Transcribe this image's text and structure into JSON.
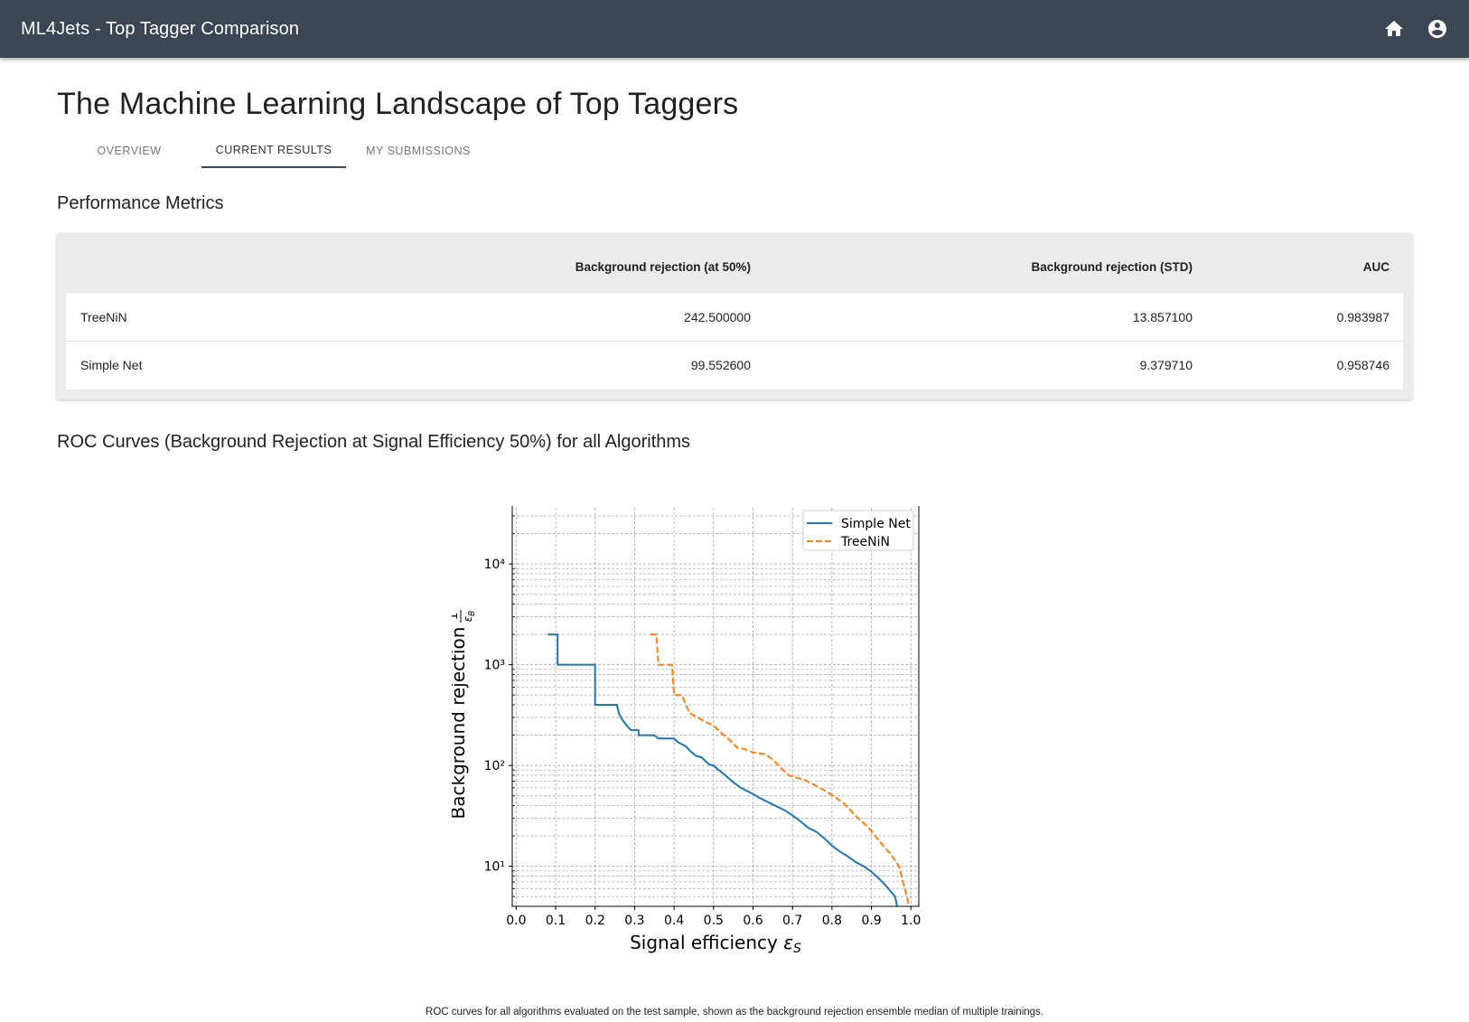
{
  "header": {
    "app_title": "ML4Jets - Top Tagger Comparison",
    "icons": [
      "home-icon",
      "account-circle-icon"
    ]
  },
  "page": {
    "title": "The Machine Learning Landscape of Top Taggers",
    "tabs": [
      {
        "label": "OVERVIEW",
        "active": false
      },
      {
        "label": "CURRENT RESULTS",
        "active": true
      },
      {
        "label": "MY SUBMISSIONS",
        "active": false
      }
    ]
  },
  "metrics": {
    "title": "Performance Metrics",
    "columns": [
      "",
      "Background rejection (at 50%)",
      "Background rejection (STD)",
      "AUC"
    ],
    "rows": [
      {
        "name": "TreeNiN",
        "rej50": "242.500000",
        "std": "13.857100",
        "auc": "0.983987"
      },
      {
        "name": "Simple Net",
        "rej50": "99.552600",
        "std": "9.379710",
        "auc": "0.958746"
      }
    ]
  },
  "roc": {
    "title": "ROC Curves (Background Rejection at Signal Efficiency 50%) for all Algorithms",
    "caption": "ROC curves for all algorithms evaluated on the test sample, shown as the background rejection ensemble median of multiple trainings."
  },
  "chart_data": {
    "type": "line",
    "xlabel": "Signal efficiency ε_S",
    "ylabel": "Background rejection 1/ε_B",
    "xlim": [
      -0.01,
      1.02
    ],
    "ylim": [
      4,
      40000
    ],
    "yscale": "log",
    "xticks": [
      "0.0",
      "0.1",
      "0.2",
      "0.3",
      "0.4",
      "0.5",
      "0.6",
      "0.7",
      "0.8",
      "0.9",
      "1.0"
    ],
    "yticks": [
      "10¹",
      "10²",
      "10³",
      "10⁴"
    ],
    "grid": true,
    "legend_position": "top-right",
    "series": [
      {
        "name": "Simple Net",
        "color": "#1f77b4",
        "style": "solid",
        "points": [
          [
            0.08,
            2000
          ],
          [
            0.105,
            2000
          ],
          [
            0.105,
            1000
          ],
          [
            0.2,
            1000
          ],
          [
            0.2,
            400
          ],
          [
            0.255,
            400
          ],
          [
            0.26,
            330
          ],
          [
            0.27,
            280
          ],
          [
            0.28,
            250
          ],
          [
            0.29,
            225
          ],
          [
            0.31,
            225
          ],
          [
            0.31,
            200
          ],
          [
            0.35,
            200
          ],
          [
            0.36,
            185
          ],
          [
            0.4,
            185
          ],
          [
            0.41,
            170
          ],
          [
            0.43,
            155
          ],
          [
            0.44,
            140
          ],
          [
            0.455,
            125
          ],
          [
            0.47,
            120
          ],
          [
            0.48,
            110
          ],
          [
            0.49,
            102
          ],
          [
            0.5,
            100
          ],
          [
            0.51,
            92
          ],
          [
            0.53,
            80
          ],
          [
            0.55,
            68
          ],
          [
            0.57,
            60
          ],
          [
            0.6,
            52
          ],
          [
            0.62,
            47
          ],
          [
            0.65,
            41
          ],
          [
            0.68,
            36
          ],
          [
            0.7,
            32
          ],
          [
            0.72,
            28
          ],
          [
            0.74,
            24
          ],
          [
            0.76,
            22
          ],
          [
            0.78,
            19
          ],
          [
            0.8,
            16
          ],
          [
            0.82,
            14
          ],
          [
            0.84,
            12.5
          ],
          [
            0.86,
            11
          ],
          [
            0.88,
            10
          ],
          [
            0.9,
            8.8
          ],
          [
            0.92,
            7.5
          ],
          [
            0.94,
            6.2
          ],
          [
            0.96,
            5
          ],
          [
            0.965,
            4
          ]
        ]
      },
      {
        "name": "TreeNiN",
        "color": "#ff7f0e",
        "style": "dashed",
        "points": [
          [
            0.34,
            2000
          ],
          [
            0.355,
            2000
          ],
          [
            0.36,
            1000
          ],
          [
            0.395,
            1000
          ],
          [
            0.4,
            500
          ],
          [
            0.42,
            500
          ],
          [
            0.43,
            400
          ],
          [
            0.44,
            330
          ],
          [
            0.46,
            300
          ],
          [
            0.48,
            270
          ],
          [
            0.5,
            250
          ],
          [
            0.52,
            210
          ],
          [
            0.54,
            180
          ],
          [
            0.56,
            150
          ],
          [
            0.58,
            145
          ],
          [
            0.6,
            135
          ],
          [
            0.63,
            130
          ],
          [
            0.65,
            115
          ],
          [
            0.67,
            95
          ],
          [
            0.69,
            80
          ],
          [
            0.71,
            76
          ],
          [
            0.73,
            72
          ],
          [
            0.75,
            66
          ],
          [
            0.77,
            60
          ],
          [
            0.79,
            54
          ],
          [
            0.81,
            48
          ],
          [
            0.83,
            42
          ],
          [
            0.85,
            35
          ],
          [
            0.87,
            29
          ],
          [
            0.89,
            25
          ],
          [
            0.91,
            20
          ],
          [
            0.93,
            16
          ],
          [
            0.95,
            13
          ],
          [
            0.97,
            10
          ],
          [
            0.98,
            7
          ],
          [
            0.99,
            5
          ],
          [
            0.995,
            4
          ]
        ]
      }
    ]
  }
}
